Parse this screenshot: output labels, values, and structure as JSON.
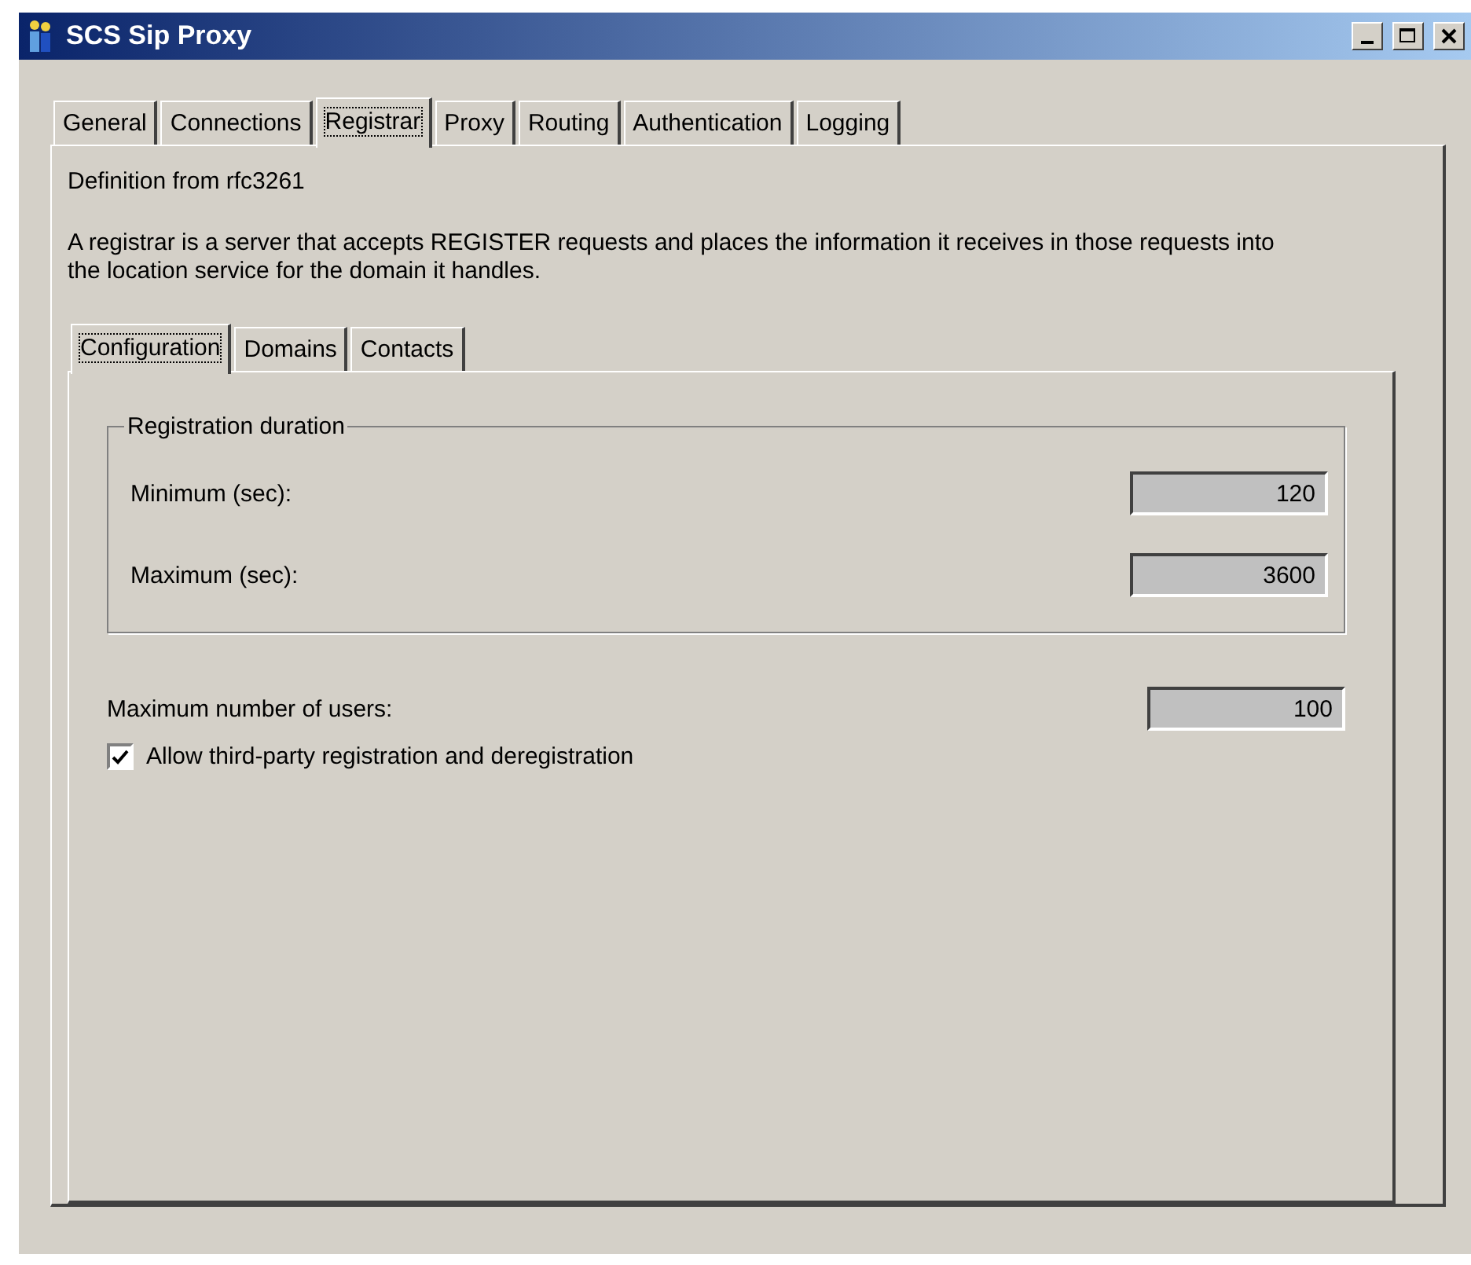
{
  "window": {
    "title": "SCS Sip Proxy"
  },
  "tabs": [
    {
      "label": "General",
      "selected": false
    },
    {
      "label": "Connections",
      "selected": false
    },
    {
      "label": "Registrar",
      "selected": true
    },
    {
      "label": "Proxy",
      "selected": false
    },
    {
      "label": "Routing",
      "selected": false
    },
    {
      "label": "Authentication",
      "selected": false
    },
    {
      "label": "Logging",
      "selected": false
    }
  ],
  "definition": "Definition from rfc3261",
  "description": "A registrar is a server that accepts REGISTER requests and places the information it receives in those requests into the location service for the domain it handles.",
  "subtabs": [
    {
      "label": "Configuration",
      "selected": true
    },
    {
      "label": "Domains",
      "selected": false
    },
    {
      "label": "Contacts",
      "selected": false
    }
  ],
  "registration_duration": {
    "title": "Registration duration",
    "fields": [
      {
        "label": "Minimum (sec):",
        "value": "120"
      },
      {
        "label": "Maximum (sec):",
        "value": "3600"
      }
    ]
  },
  "max_users": {
    "label": "Maximum number of users:",
    "value": "100"
  },
  "third_party": {
    "label": "Allow third-party registration and deregistration",
    "checked": true
  }
}
